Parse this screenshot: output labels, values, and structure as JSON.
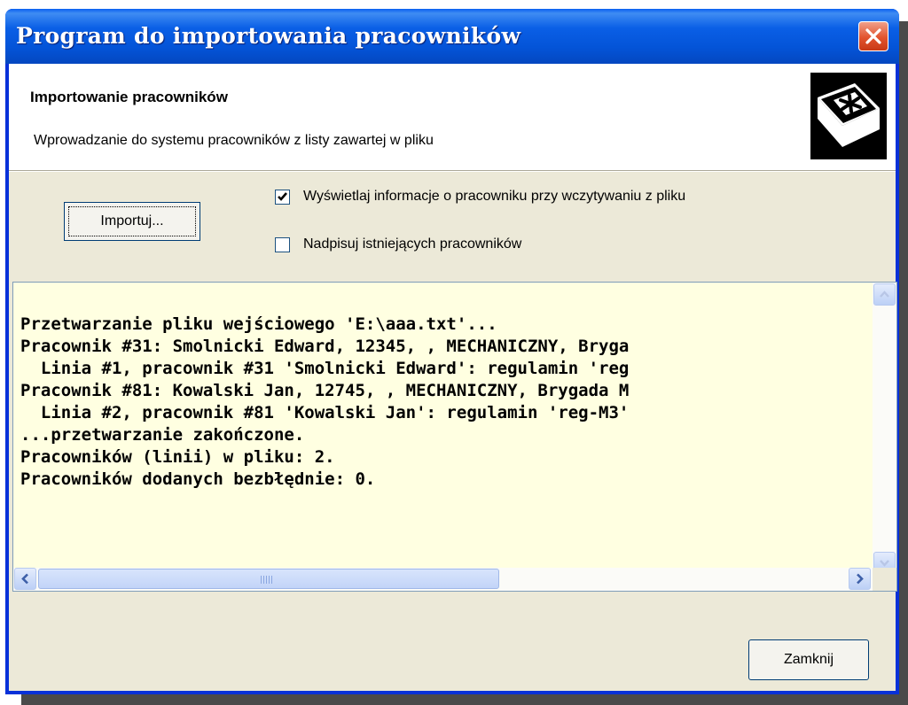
{
  "window": {
    "title": "Program do importowania pracowników"
  },
  "header": {
    "title": "Importowanie pracowników",
    "subtitle": "Wprowadzanie do systemu pracowników z listy zawartej w pliku"
  },
  "buttons": {
    "import_label": "Importuj...",
    "close_label": "Zamknij"
  },
  "options": [
    {
      "label": "Wyświetlaj informacje o pracowniku przy wczytywaniu z pliku",
      "checked": true
    },
    {
      "label": "Nadpisuj istniejących pracowników",
      "checked": false
    }
  ],
  "log": {
    "lines": [
      "Przetwarzanie pliku wejściowego 'E:\\aaa.txt'...",
      "Pracownik #31: Smolnicki Edward, 12345, , MECHANICZNY, Bryga",
      "  Linia #1, pracownik #31 'Smolnicki Edward': regulamin 'reg",
      "Pracownik #81: Kowalski Jan, 12745, , MECHANICZNY, Brygada M",
      "  Linia #2, pracownik #81 'Kowalski Jan': regulamin 'reg-M3'",
      "...przetwarzanie zakończone.",
      "Pracowników (linii) w pliku: 2.",
      "Pracowników dodanych bezbłędnie: 0."
    ]
  },
  "icons": {
    "close": "close-icon",
    "wizard": "asterisk-key-icon"
  },
  "colors": {
    "titlebar": "#0454d8",
    "dialog_bg": "#ece9d8",
    "log_bg": "#ffffe1",
    "close_button": "#e2532d"
  }
}
